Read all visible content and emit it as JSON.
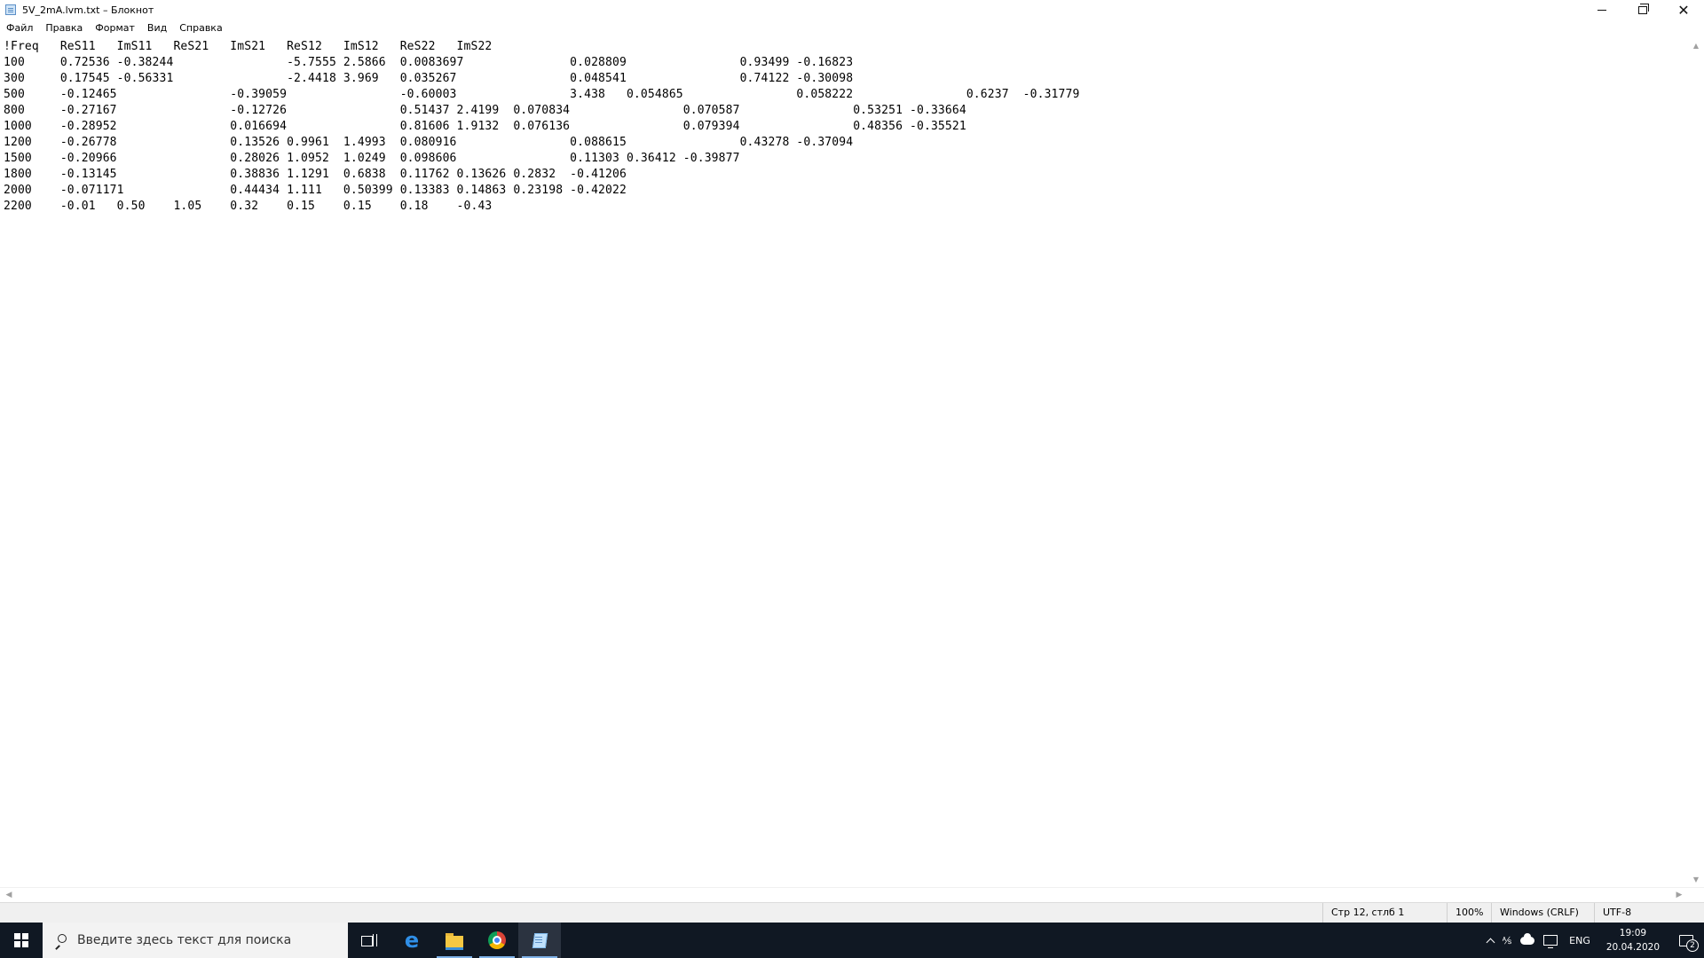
{
  "window": {
    "title": "5V_2mA.lvm.txt – Блокнот",
    "controls": {
      "minimize": "—",
      "maximize": "❐",
      "close": "✕"
    }
  },
  "menu": [
    {
      "label": "Файл"
    },
    {
      "label": "Правка"
    },
    {
      "label": "Формат"
    },
    {
      "label": "Вид"
    },
    {
      "label": "Справка"
    }
  ],
  "editor": {
    "lines": [
      "!Freq\tReS11\tImS11\tReS21\tImS21\tReS12\tImS12\tReS22\tImS22",
      "100\t0.72536\t-0.38244\t\t-5.7555\t2.5866\t0.0083697\t\t0.028809\t\t0.93499\t-0.16823",
      "300\t0.17545\t-0.56331\t\t-2.4418\t3.969\t0.035267\t\t0.048541\t\t0.74122\t-0.30098",
      "500\t-0.12465\t\t-0.39059\t\t-0.60003\t\t3.438\t0.054865\t\t0.058222\t\t0.6237\t-0.31779",
      "800\t-0.27167\t\t-0.12726\t\t0.51437\t2.4199\t0.070834\t\t0.070587\t\t0.53251\t-0.33664",
      "1000\t-0.28952\t\t0.016694\t\t0.81606\t1.9132\t0.076136\t\t0.079394\t\t0.48356\t-0.35521",
      "1200\t-0.26778\t\t0.13526\t0.9961\t1.4993\t0.080916\t\t0.088615\t\t0.43278\t-0.37094",
      "1500\t-0.20966\t\t0.28026\t1.0952\t1.0249\t0.098606\t\t0.11303\t0.36412\t-0.39877",
      "1800\t-0.13145\t\t0.38836\t1.1291\t0.6838\t0.11762\t0.13626\t0.2832\t-0.41206",
      "2000\t-0.071171\t\t0.44434\t1.111\t0.50399\t0.13383\t0.14863\t0.23198\t-0.42022",
      "2200\t-0.01\t0.50\t1.05\t0.32\t0.15\t0.15\t0.18\t-0.43"
    ]
  },
  "statusbar": {
    "position": "Стр 12, стлб 1",
    "zoom": "100%",
    "line_endings": "Windows (CRLF)",
    "encoding": "UTF-8"
  },
  "taskbar": {
    "search_placeholder": "Введите здесь текст для поиска",
    "apps": [
      {
        "icon": "task-view-icon"
      },
      {
        "icon": "edge-icon",
        "glyph": "e"
      },
      {
        "icon": "file-explorer-icon"
      },
      {
        "icon": "chrome-icon"
      },
      {
        "icon": "notepad-icon"
      }
    ],
    "tray": {
      "ime": "⅍",
      "language": "ENG",
      "time": "19:09",
      "date": "20.04.2020",
      "notification_count": "2"
    }
  }
}
